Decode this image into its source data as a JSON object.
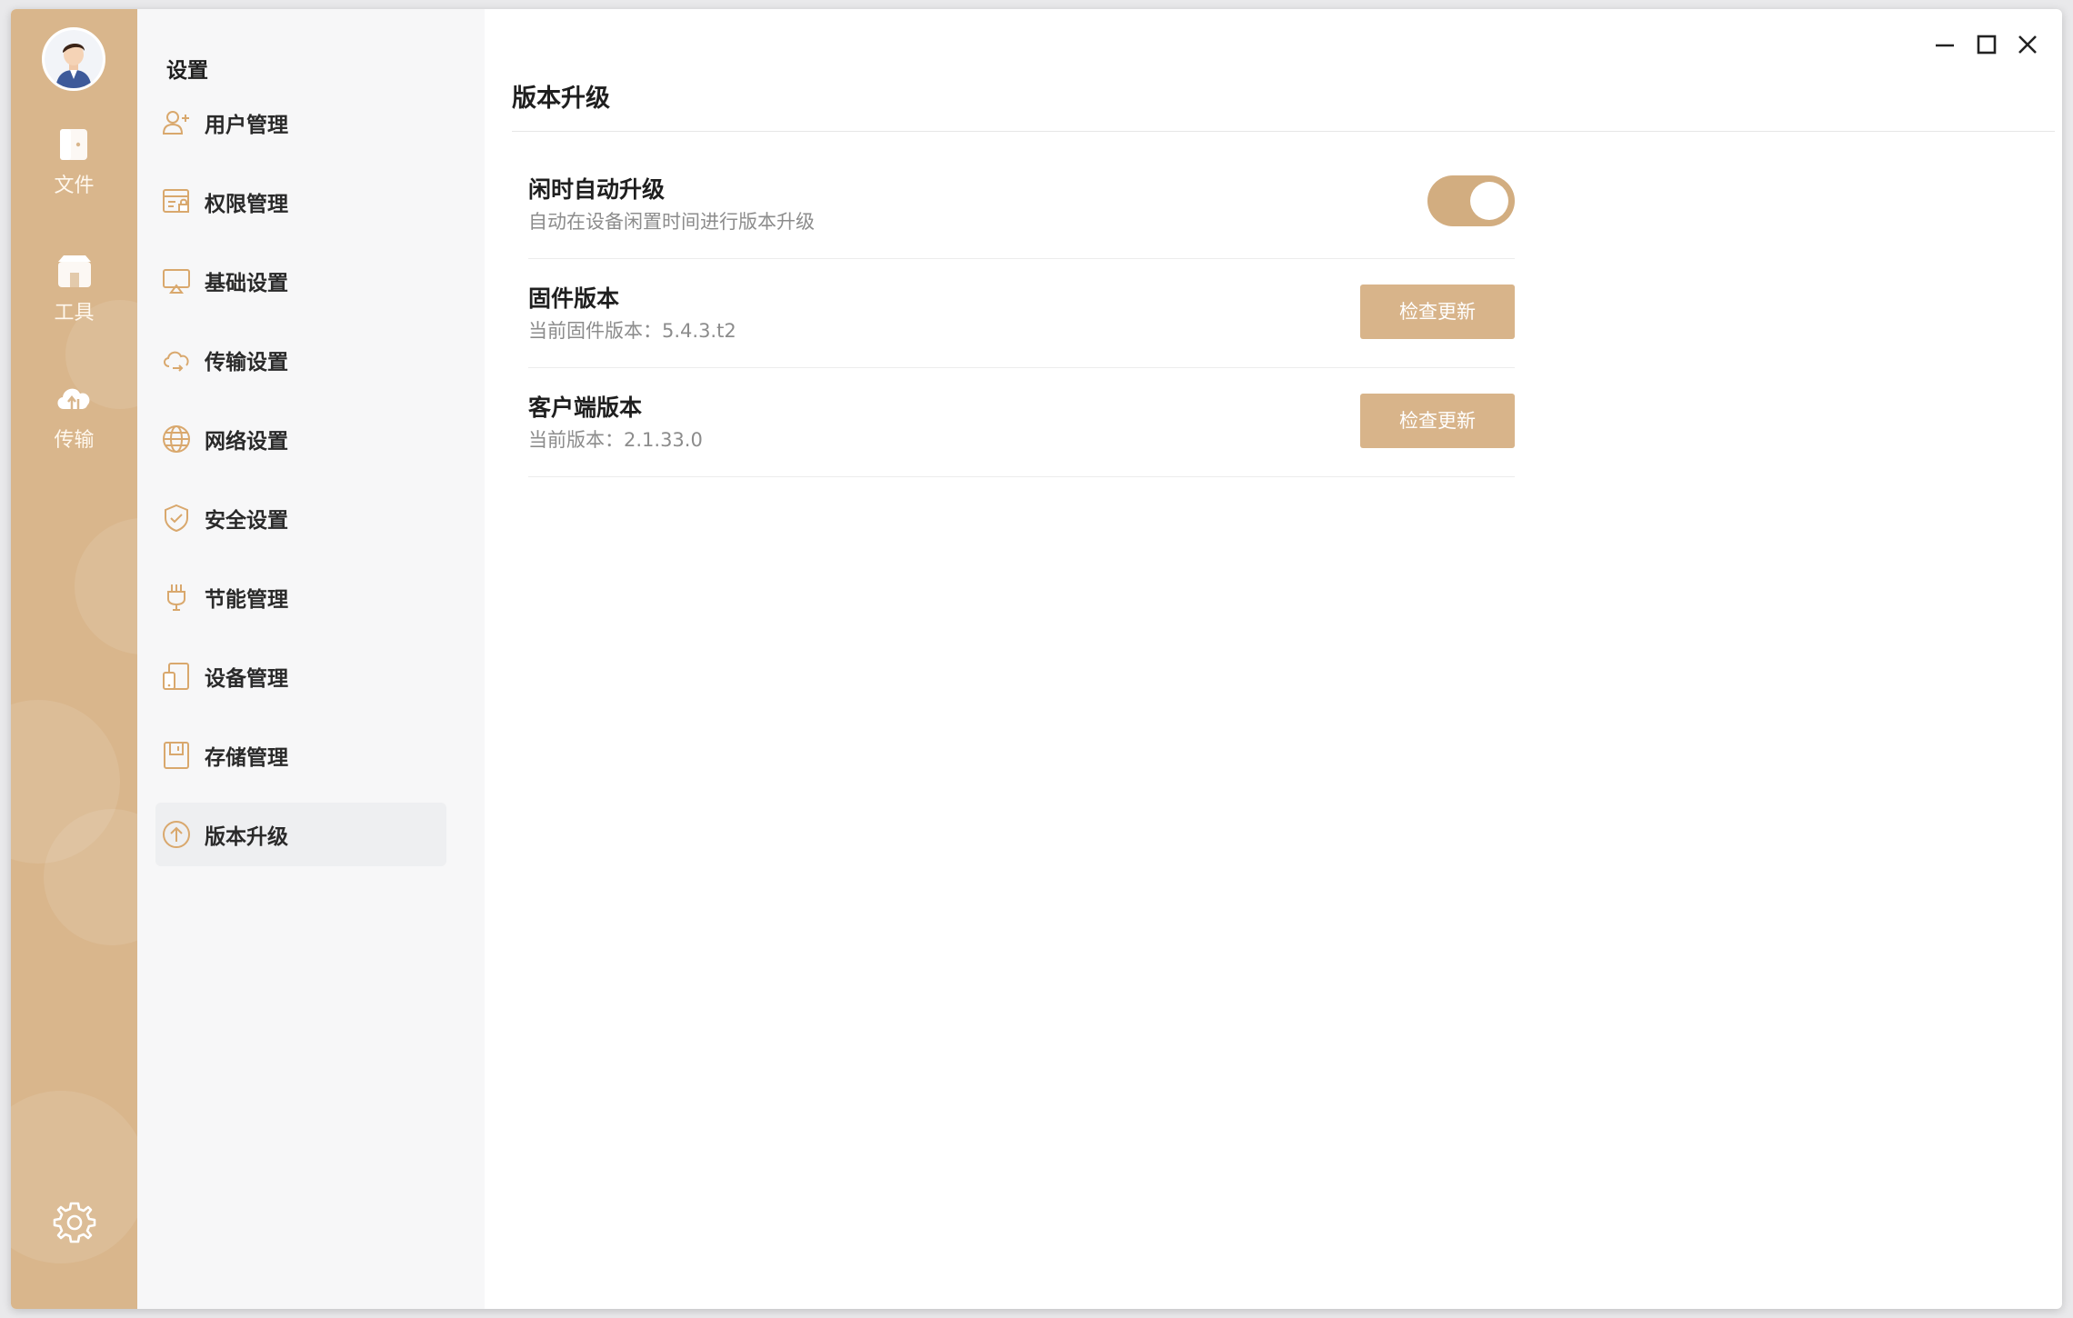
{
  "colors": {
    "accent": "#d9b68c",
    "button": "#d8b48a",
    "toggle_on": "#d2ad80"
  },
  "rail": {
    "avatar": "user-avatar",
    "items": [
      {
        "label": "文件",
        "icon": "file-icon"
      },
      {
        "label": "工具",
        "icon": "toolbox-icon"
      },
      {
        "label": "传输",
        "icon": "cloud-transfer-icon"
      }
    ],
    "settings_icon": "gear-icon"
  },
  "nav": {
    "title": "设置",
    "items": [
      {
        "label": "用户管理",
        "icon": "user-add-icon"
      },
      {
        "label": "权限管理",
        "icon": "permission-icon"
      },
      {
        "label": "基础设置",
        "icon": "monitor-icon"
      },
      {
        "label": "传输设置",
        "icon": "cloud-sync-icon"
      },
      {
        "label": "网络设置",
        "icon": "globe-icon"
      },
      {
        "label": "安全设置",
        "icon": "shield-icon"
      },
      {
        "label": "节能管理",
        "icon": "plug-icon"
      },
      {
        "label": "设备管理",
        "icon": "device-icon"
      },
      {
        "label": "存储管理",
        "icon": "storage-icon"
      },
      {
        "label": "版本升级",
        "icon": "upgrade-icon"
      }
    ],
    "active_index": 9
  },
  "main": {
    "title": "版本升级",
    "auto_upgrade": {
      "title": "闲时自动升级",
      "desc": "自动在设备闲置时间进行版本升级",
      "enabled": true
    },
    "firmware": {
      "title": "固件版本",
      "desc": "当前固件版本：5.4.3.t2",
      "button": "检查更新"
    },
    "client": {
      "title": "客户端版本",
      "desc": "当前版本：2.1.33.0",
      "button": "检查更新"
    }
  },
  "window_controls": [
    "minimize-icon",
    "maximize-icon",
    "close-icon"
  ]
}
